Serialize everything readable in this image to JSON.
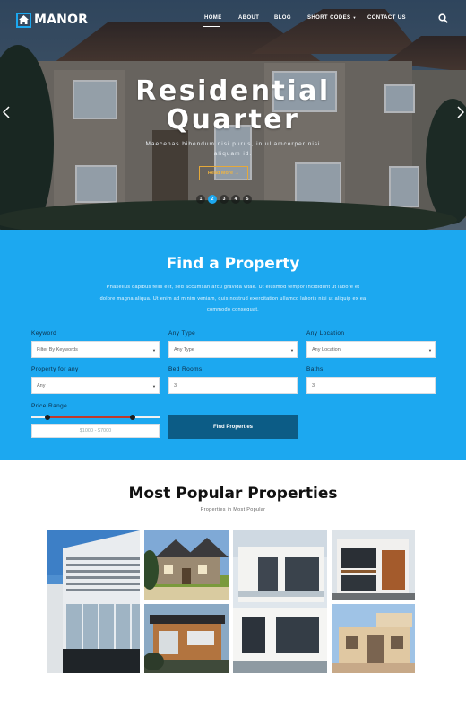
{
  "brand": {
    "name": "MANOR",
    "accent": "#1ca8f0",
    "logo_icon": "home-icon"
  },
  "nav": {
    "items": [
      {
        "label": "HOME",
        "active": true
      },
      {
        "label": "ABOUT",
        "active": false
      },
      {
        "label": "BLOG",
        "active": false
      },
      {
        "label": "SHORT CODES",
        "active": false,
        "has_dropdown": true
      },
      {
        "label": "CONTACT US",
        "active": false
      }
    ],
    "search_icon": "search-icon"
  },
  "hero": {
    "title_line1": "Residential",
    "title_line2": "Quarter",
    "subtitle": "Maecenas bibendum nisi purus, in ullamcorper nisi aliquam id.",
    "button_label": "Read More →",
    "slides": [
      "1",
      "2",
      "3",
      "4",
      "5"
    ],
    "active_slide": 2,
    "prev_icon": "chevron-left-icon",
    "next_icon": "chevron-right-icon"
  },
  "find": {
    "title": "Find a Property",
    "description": "Phasellus dapibus felis elit, sed accumsan arcu gravida vitae. Ut eiusmod tempor incididunt ut labore et dolore magna aliqua. Ut enim ad minim veniam, quis nostrud exercitation ullamco laboris nisi ut aliquip ex ea commodo consequat.",
    "fields": {
      "keyword": {
        "label": "Keyword",
        "value": "Filter By Keywords"
      },
      "type": {
        "label": "Any Type",
        "value": "Any Type"
      },
      "location": {
        "label": "Any Location",
        "value": "Any Location"
      },
      "property": {
        "label": "Property for any",
        "value": "Any"
      },
      "bedrooms": {
        "label": "Bed Rooms",
        "value": "3"
      },
      "baths": {
        "label": "Baths",
        "value": "3"
      }
    },
    "price": {
      "label": "Price Range",
      "display": "$1000 - $7000",
      "min": 1000,
      "max": 7000
    },
    "button_label": "Find Properties",
    "colors": {
      "background": "#1ca8f0",
      "button": "#0c5c86",
      "slider_fill": "#c0392b"
    }
  },
  "popular": {
    "title": "Most Popular Properties",
    "subtitle": "Properties in Most Popular"
  }
}
